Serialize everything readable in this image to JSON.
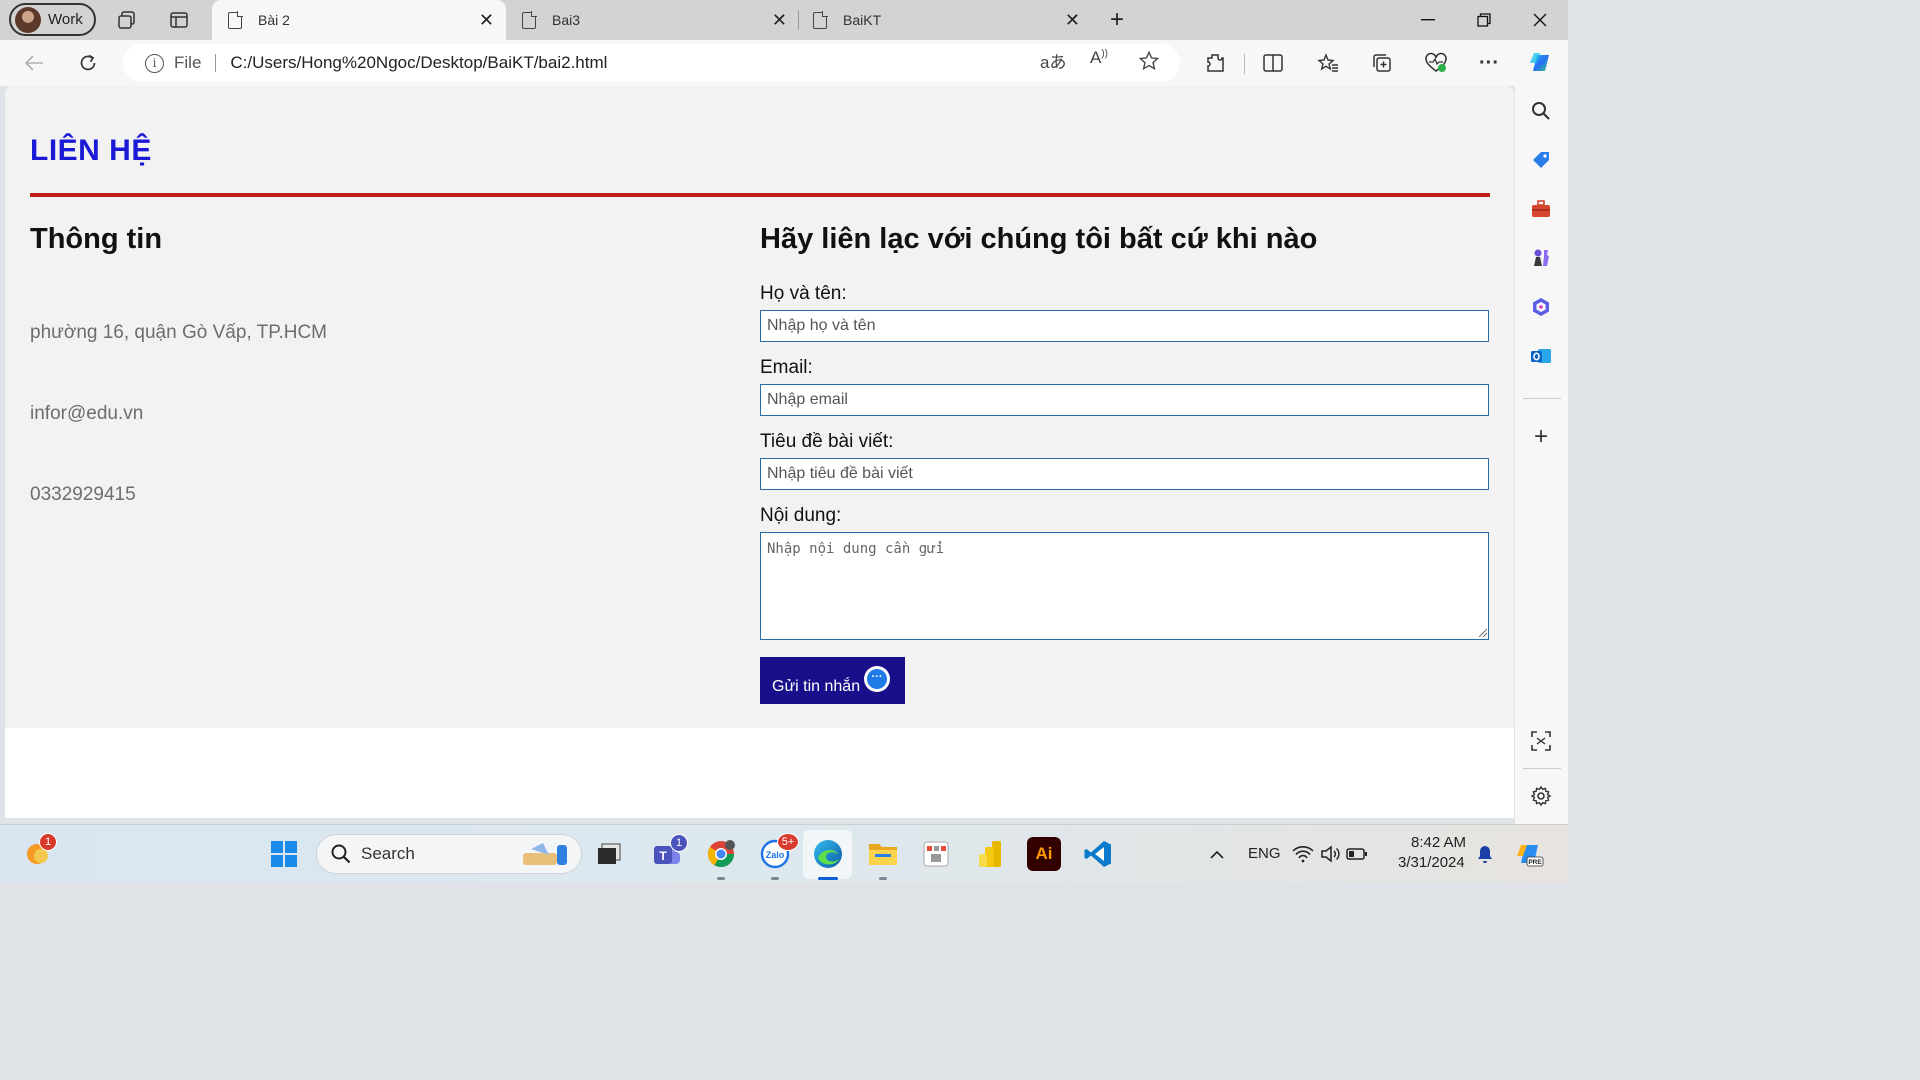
{
  "browser": {
    "profile_label": "Work",
    "tabs": [
      {
        "title": "Bài 2"
      },
      {
        "title": "Bai3"
      },
      {
        "title": "BaiKT"
      }
    ],
    "address": {
      "scheme_label": "File",
      "url": "C:/Users/Hong%20Ngoc/Desktop/BaiKT/bai2.html"
    },
    "new_tab_symbol": "+",
    "colors": {
      "tab_strip": "#d3d3d3",
      "toolbar": "#f7f7f7"
    }
  },
  "page": {
    "heading": "LIÊN HỆ",
    "info": {
      "title": "Thông tin",
      "address": "phường 16, quận Gò Vấp, TP.HCM",
      "email": "infor@edu.vn",
      "phone": "0332929415"
    },
    "form": {
      "title": "Hãy liên lạc với chúng tôi bất cứ khi nào",
      "name_label": "Họ và tên:",
      "name_placeholder": "Nhập họ và tên",
      "email_label": "Email:",
      "email_placeholder": "Nhập email",
      "subject_label": "Tiêu đề bài viết:",
      "subject_placeholder": "Nhập tiêu đề bài viết",
      "content_label": "Nội dung:",
      "content_placeholder": "Nhập nội dung cần gửi",
      "submit_label": "Gửi tin nhắn"
    },
    "colors": {
      "heading": "#1a1ad6",
      "rule": "#c0201a",
      "button": "#1a0f8a",
      "input_border": "#2a6aa5"
    }
  },
  "taskbar": {
    "search_placeholder": "Search",
    "language": "ENG",
    "time": "8:42 AM",
    "date": "3/31/2024",
    "badges": {
      "weather": "1",
      "teams": "1",
      "zalo": "5+"
    },
    "apps": [
      "weather-icon",
      "windows-start-icon",
      "task-view-icon",
      "teams-icon",
      "chrome-icon",
      "zalo-icon",
      "edge-icon",
      "file-explorer-icon",
      "app-icon",
      "power-bi-icon",
      "illustrator-icon",
      "vscode-icon"
    ]
  }
}
